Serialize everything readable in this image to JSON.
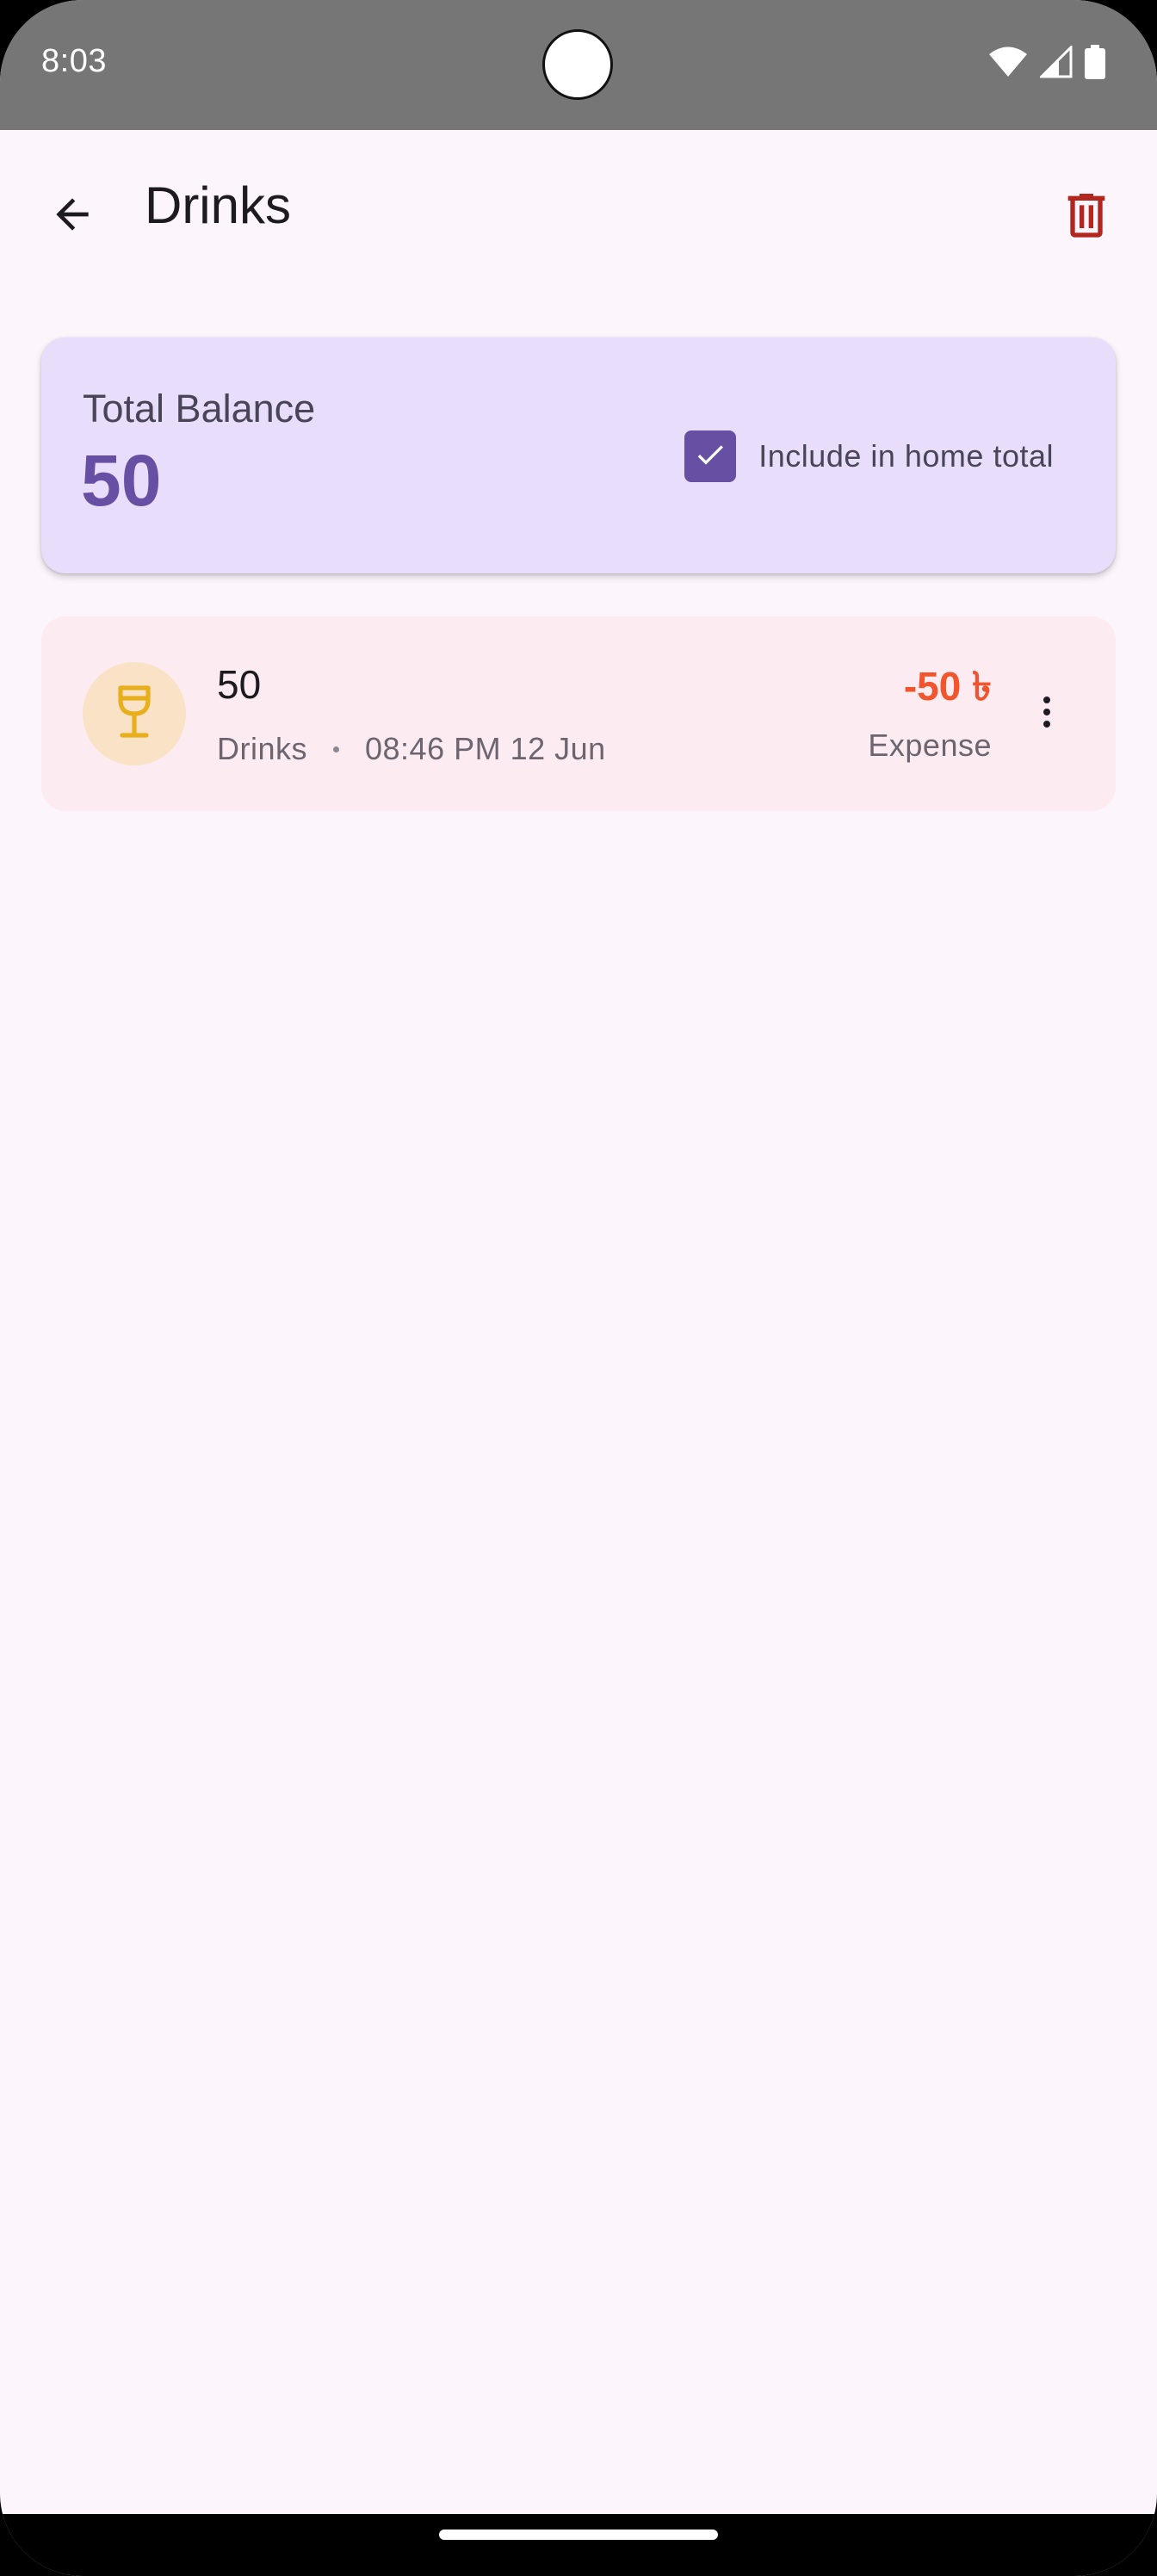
{
  "status_bar": {
    "time": "8:03",
    "icons": [
      "wifi-icon",
      "cellular-signal-icon",
      "battery-icon"
    ]
  },
  "app_bar": {
    "title": "Drinks",
    "back_icon": "arrow-back-icon",
    "delete_icon": "trash-icon"
  },
  "balance_card": {
    "label": "Total Balance",
    "value": "50",
    "include_label": "Include in home total",
    "include_checked": true
  },
  "transactions": [
    {
      "title": "50",
      "category": "Drinks",
      "datetime": "08:46 PM 12 Jun",
      "amount": "-50 ৳",
      "type": "Expense",
      "icon": "wine-glass-icon"
    }
  ],
  "colors": {
    "background": "#FCF5FC",
    "status_bar": "#767676",
    "card": "#E8DDFB",
    "primary": "#6750A4",
    "expense": "#F2542D",
    "delete": "#B3261E",
    "transaction_bg": "#FCEBF0",
    "icon_bg": "#FAE2C6",
    "icon_fg": "#E8AE1C"
  }
}
